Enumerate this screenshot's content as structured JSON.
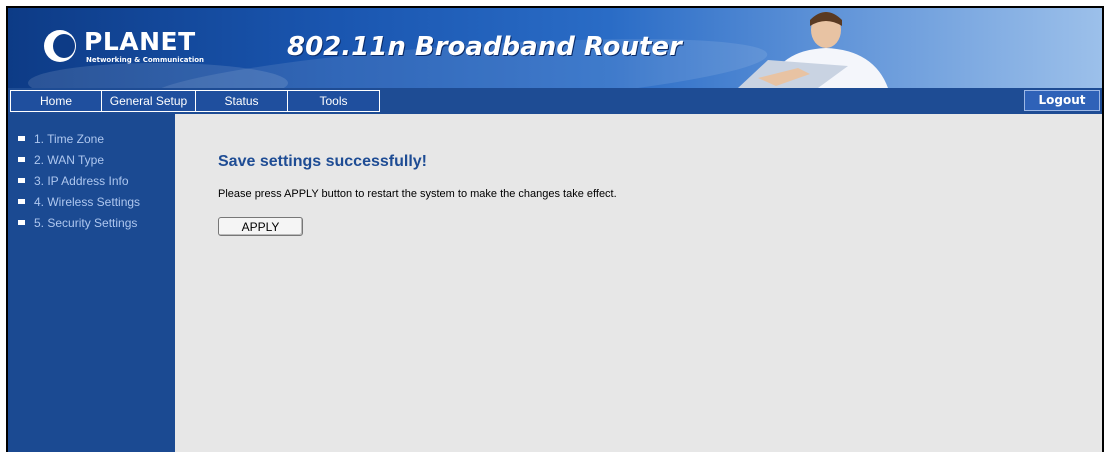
{
  "brand": {
    "logo": "PLANET",
    "logo_sub": "Networking & Communication",
    "product": "802.11n Broadband Router"
  },
  "nav": {
    "tabs": [
      {
        "label": "Home"
      },
      {
        "label": "General Setup"
      },
      {
        "label": "Status"
      },
      {
        "label": "Tools"
      }
    ],
    "logout": "Logout"
  },
  "sidebar": {
    "items": [
      {
        "label": "1. Time Zone"
      },
      {
        "label": "2. WAN Type"
      },
      {
        "label": "3. IP Address Info"
      },
      {
        "label": "4. Wireless Settings"
      },
      {
        "label": "5. Security Settings"
      }
    ]
  },
  "main": {
    "title": "Save settings successfully!",
    "message": "Please press APPLY button to restart the system to make the changes take effect.",
    "apply_label": "APPLY"
  },
  "colors": {
    "nav_blue": "#1e4c94",
    "sidebar_blue": "#1b4a92",
    "content_bg": "#e7e7e7",
    "title_blue": "#1e4c94"
  }
}
